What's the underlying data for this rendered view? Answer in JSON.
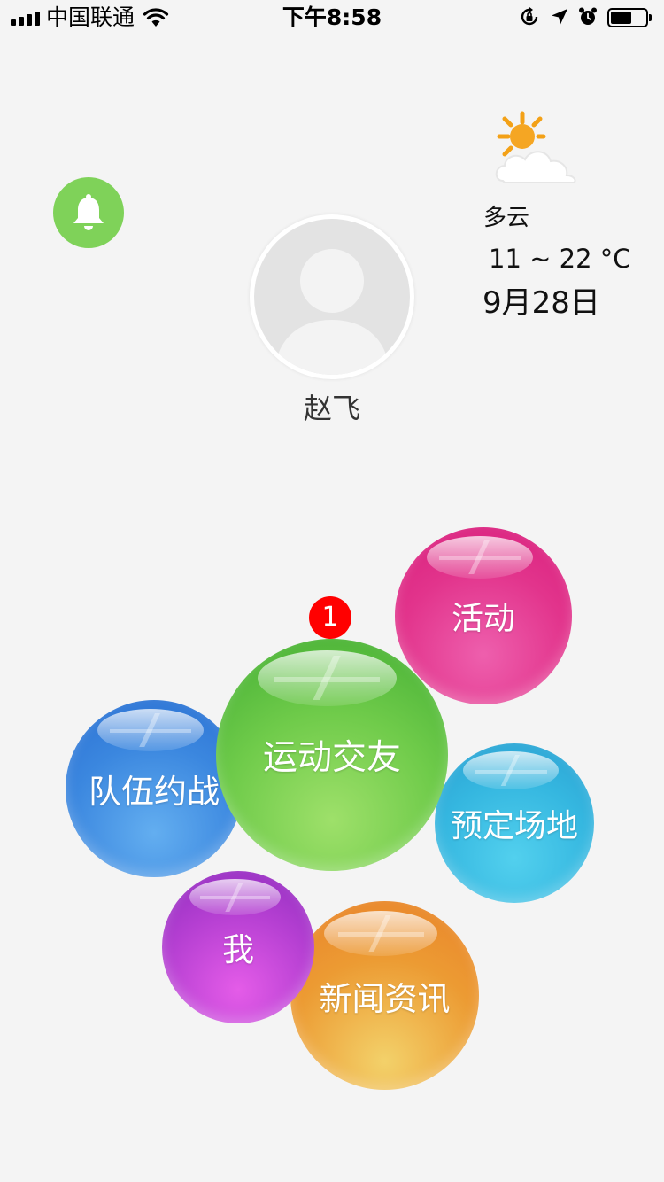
{
  "status_bar": {
    "carrier": "中国联通",
    "time": "下午8:58",
    "battery_level": 0.6
  },
  "profile": {
    "name": "赵飞"
  },
  "weather": {
    "condition": "多云",
    "temperature": "11 ~ 22 °C",
    "date": "9月28日"
  },
  "menu": {
    "activity": "活动",
    "team_match": "队伍约战",
    "sports_social": "运动交友",
    "sports_social_badge": "1",
    "book_venue": "预定场地",
    "me": "我",
    "news": "新闻资讯"
  },
  "colors": {
    "bell": "#7fd259",
    "activity": "#e2348c",
    "team_match": "#3b87df",
    "sports_social": "#6fcb4a",
    "book_venue": "#35b7e0",
    "me": "#b53fd2",
    "news": "#ec9b33",
    "badge": "#ff0000"
  }
}
